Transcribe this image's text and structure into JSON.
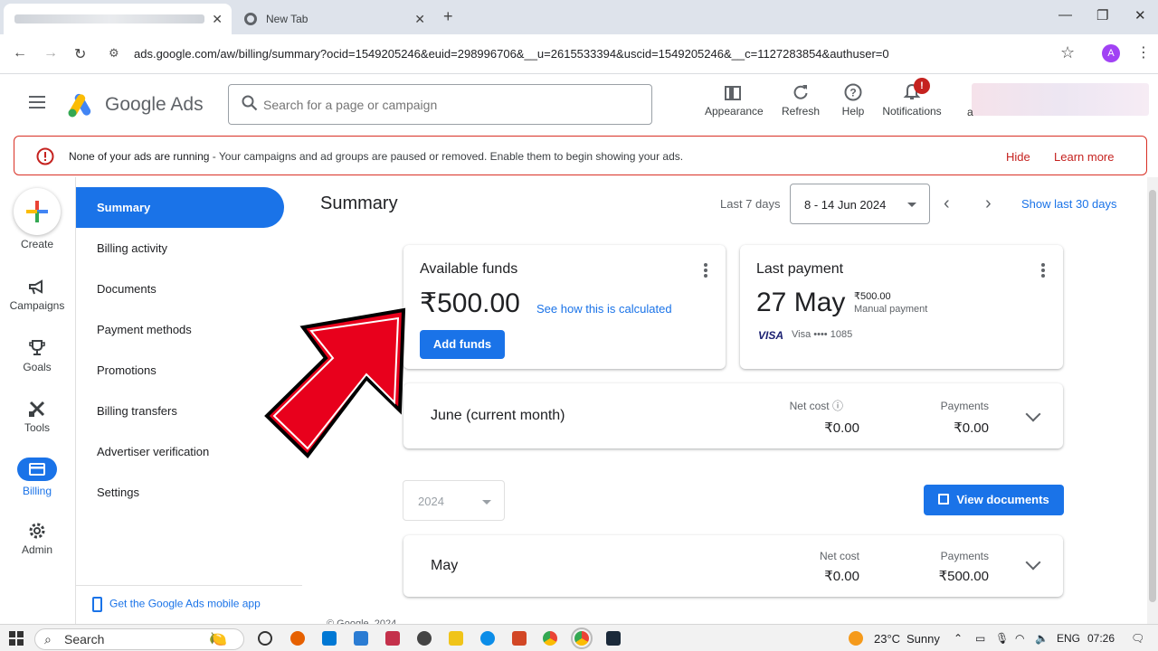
{
  "browser": {
    "tab2_title": "New Tab",
    "url": "ads.google.com/aw/billing/summary?ocid=1549205246&euid=298996706&__u=2615533394&uscid=1549205246&__c=1127283854&authuser=0",
    "avatar_letter": "A"
  },
  "header": {
    "brand": "Google Ads",
    "search_placeholder": "Search for a page or campaign",
    "tools": {
      "appearance": "Appearance",
      "refresh": "Refresh",
      "help": "Help",
      "notifications": "Notifications"
    },
    "notif_badge": "!",
    "account_letter": "a"
  },
  "alert": {
    "title": "None of your ads are running",
    "message": " - Your campaigns and ad groups are paused or removed. Enable them to begin showing your ads.",
    "hide": "Hide",
    "learn_more": "Learn more"
  },
  "rail": {
    "create": "Create",
    "campaigns": "Campaigns",
    "goals": "Goals",
    "tools": "Tools",
    "billing": "Billing",
    "admin": "Admin"
  },
  "subnav": {
    "items": [
      "Summary",
      "Billing activity",
      "Documents",
      "Payment methods",
      "Promotions",
      "Billing transfers",
      "Advertiser verification",
      "Settings"
    ],
    "mobile_app": "Get the Google Ads mobile app"
  },
  "summary": {
    "title": "Summary",
    "range_label": "Last 7 days",
    "date_range": "8 - 14 Jun 2024",
    "show_30": "Show last 30 days"
  },
  "funds": {
    "label": "Available funds",
    "amount": "₹500.00",
    "how_calc": "See how this is calculated",
    "add_funds": "Add funds"
  },
  "last_payment": {
    "label": "Last payment",
    "date": "27 May",
    "amount": "₹500.00",
    "type": "Manual payment",
    "card_brand": "VISA",
    "card": "Visa •••• 1085"
  },
  "june": {
    "month": "June (current month)",
    "net_cost_label": "Net cost",
    "net_cost": "₹0.00",
    "payments_label": "Payments",
    "payments": "₹0.00"
  },
  "year": "2024",
  "view_documents": "View documents",
  "may": {
    "month": "May",
    "net_cost_label": "Net cost",
    "net_cost": "₹0.00",
    "payments_label": "Payments",
    "payments": "₹500.00"
  },
  "footer": "© Google, 2024",
  "taskbar": {
    "search": "Search",
    "weather": "23°C",
    "condition": "Sunny",
    "lang": "ENG",
    "time": "07:26"
  }
}
